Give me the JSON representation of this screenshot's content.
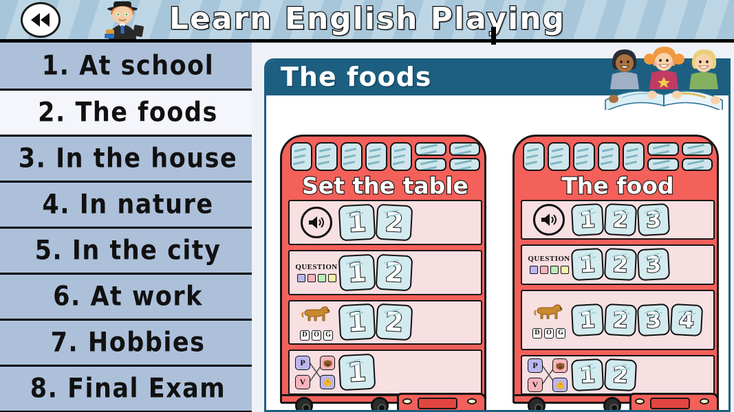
{
  "header": {
    "title": "Learn English Playing",
    "back_icon": "rewind-back-icon",
    "mascot_icon": "teacher-mascot-icon"
  },
  "sidebar": {
    "items": [
      {
        "label": "1. At school",
        "selected": false
      },
      {
        "label": "2. The foods",
        "selected": true
      },
      {
        "label": "3. In the house",
        "selected": false
      },
      {
        "label": "4. In nature",
        "selected": false
      },
      {
        "label": "5. In the city",
        "selected": false
      },
      {
        "label": "6. At work",
        "selected": false
      },
      {
        "label": "7. Hobbies",
        "selected": false
      },
      {
        "label": "8. Final Exam",
        "selected": false
      }
    ]
  },
  "content": {
    "panel_title": "The foods",
    "kids_icon": "three-kids-reading-book-icon",
    "cards": [
      {
        "heading": "Set the table",
        "rows": [
          {
            "gadget": "speaker",
            "speaker_icon": "speaker-sound-icon",
            "tiles": [
              "1",
              "2"
            ]
          },
          {
            "gadget": "question",
            "question_label": "QUESTION",
            "swatch_colors": [
              "#bcb6ee",
              "#f7b4bc",
              "#b9efb7",
              "#f5f2a8"
            ],
            "tiles": [
              "1",
              "2"
            ]
          },
          {
            "gadget": "dog",
            "dog_icon": "dog-illustration-icon",
            "word_letters": [
              "D",
              "O",
              "G"
            ],
            "tiles": [
              "1",
              "2"
            ]
          },
          {
            "gadget": "match",
            "left_letters": [
              "P",
              "V"
            ],
            "right_icons": [
              "pig-face-icon",
              "chick-face-icon"
            ],
            "tiles": [
              "1"
            ]
          }
        ]
      },
      {
        "heading": "The food",
        "rows": [
          {
            "gadget": "speaker",
            "speaker_icon": "speaker-sound-icon",
            "tiles": [
              "1",
              "2",
              "3"
            ]
          },
          {
            "gadget": "question",
            "question_label": "QUESTION",
            "swatch_colors": [
              "#bcb6ee",
              "#f7b4bc",
              "#b9efb7",
              "#f5f2a8"
            ],
            "tiles": [
              "1",
              "2",
              "3"
            ]
          },
          {
            "gadget": "dog",
            "dog_icon": "dog-illustration-icon",
            "word_letters": [
              "D",
              "O",
              "G"
            ],
            "tiles": [
              "1",
              "2",
              "3",
              "4"
            ]
          },
          {
            "gadget": "match",
            "left_letters": [
              "P",
              "V"
            ],
            "right_icons": [
              "pig-face-icon",
              "chick-face-icon"
            ],
            "tiles": [
              "1",
              "2"
            ]
          }
        ]
      }
    ]
  },
  "colors": {
    "header_stripe_dark": "#a8c6da",
    "header_stripe_light": "#bdd6e5",
    "sidebar_item": "#adc0da",
    "sidebar_item_selected": "#f4f6fb",
    "panel_accent": "#1d5f80",
    "bus_red": "#f4605a",
    "tile_blue": "#d3ebef",
    "row_pink": "#f7dfe2"
  }
}
